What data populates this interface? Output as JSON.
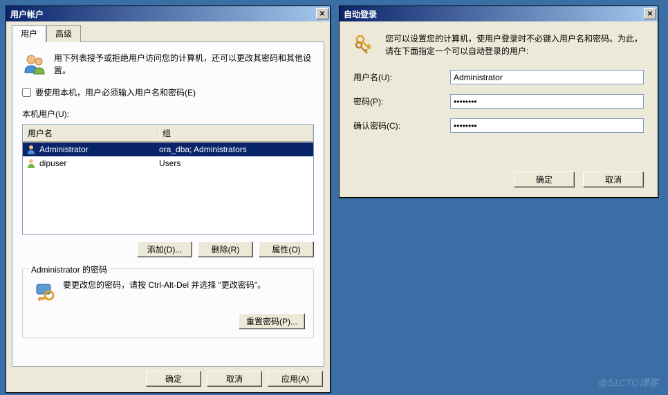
{
  "window1": {
    "title": "用户帐户",
    "tabs": {
      "users": "用户",
      "advanced": "高级"
    },
    "intro": "用下列表授予或拒绝用户访问您的计算机，还可以更改其密码和其他设置。",
    "require_checkbox_label": "要使用本机，用户必须输入用户名和密码(E)",
    "require_checked": false,
    "list_label": "本机用户(U):",
    "columns": {
      "name": "用户名",
      "group": "组"
    },
    "users": [
      {
        "name": "Administrator",
        "group": "ora_dba; Administrators",
        "selected": true
      },
      {
        "name": "dipuser",
        "group": "Users",
        "selected": false
      }
    ],
    "buttons": {
      "add": "添加(D)...",
      "remove": "删除(R)",
      "properties": "属性(O)"
    },
    "password_box": {
      "title": "Administrator 的密码",
      "text": "要更改您的密码，请按 Ctrl-Alt-Del 并选择 \"更改密码\"。",
      "reset": "重置密码(P)..."
    },
    "footer": {
      "ok": "确定",
      "cancel": "取消",
      "apply": "应用(A)"
    }
  },
  "window2": {
    "title": "自动登录",
    "intro": "您可以设置您的计算机，使用户登录时不必键入用户名和密码。为此，请在下面指定一个可以自动登录的用户:",
    "labels": {
      "username": "用户名(U):",
      "password": "密码(P):",
      "confirm": "确认密码(C):"
    },
    "values": {
      "username": "Administrator",
      "password": "••••••••",
      "confirm": "••••••••"
    },
    "buttons": {
      "ok": "确定",
      "cancel": "取消"
    }
  },
  "watermark": "@51CTO博客"
}
